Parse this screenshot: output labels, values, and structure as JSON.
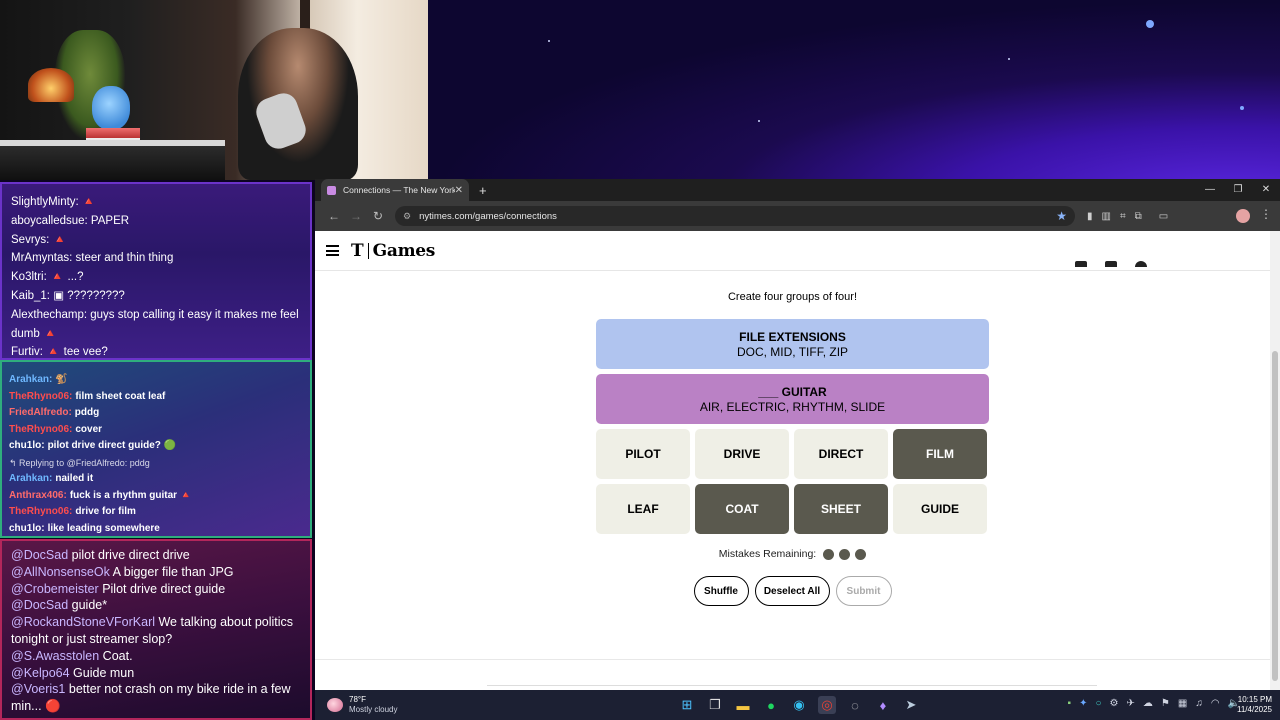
{
  "chat_panel_1": {
    "lines": [
      "SlightlyMinty: 🔺",
      "aboycalledsue: PAPER",
      "Sevrys: 🔺",
      "MrAmyntas: steer and thin thing",
      "Ko3ltri: 🔺 ...?",
      "Kaib_1: ▣ ?????????",
      "Alexthechamp: guys stop calling it easy it makes me feel dumb 🔺",
      "Furtiv: 🔺 tee vee?"
    ]
  },
  "chat_panel_2": {
    "lines": [
      {
        "user": "Arahkan:",
        "text": "🐒",
        "color": "#6fb8ff"
      },
      {
        "user": "TheRhyno06:",
        "text": "film sheet coat leaf",
        "color": "#ff4d4d"
      },
      {
        "user": "FriedAlfredo:",
        "text": "pddg",
        "color": "#ff6b6b"
      },
      {
        "user": "TheRhyno06:",
        "text": "cover",
        "color": "#ff4d4d"
      },
      {
        "user": "chu1lo:",
        "text": "pilot drive direct guide? 🟢",
        "color": "#ffffff"
      },
      {
        "user": "",
        "text": "↰ Replying to @FriedAlfredo: pddg",
        "color": "#d8d8e8",
        "reply": true
      },
      {
        "user": "Arahkan:",
        "text": "nailed it",
        "color": "#6fb8ff"
      },
      {
        "user": "Anthrax406:",
        "text": "fuck is a rhythm guitar 🔺",
        "color": "#ff6b6b"
      },
      {
        "user": "TheRhyno06:",
        "text": "drive for film",
        "color": "#ff4d4d"
      },
      {
        "user": "chu1lo:",
        "text": "like leading somewhere",
        "color": "#ffffff"
      }
    ]
  },
  "chat_panel_3": {
    "lines": [
      {
        "user": "@DocSad",
        "text": " pilot drive direct drive"
      },
      {
        "user": "@AllNonsenseOk",
        "text": " A bigger file than JPG"
      },
      {
        "user": "@Crobemeister",
        "text": " Pilot drive direct guide"
      },
      {
        "user": "@DocSad",
        "text": " guide*"
      },
      {
        "user": "@RockandStoneVForKarl",
        "text": " We talking about politics tonight or just streamer slop?"
      },
      {
        "user": "@S.Awasstolen",
        "text": " Coat."
      },
      {
        "user": "@Kelpo64",
        "text": " Guide mun"
      },
      {
        "user": "@Voeris1",
        "text": " better not crash on my bike ride in a few min... 🔴"
      }
    ]
  },
  "browser": {
    "tab_title": "Connections — The New York",
    "tab_close": "✕",
    "new_tab": "+",
    "url": "nytimes.com/games/connections",
    "window_controls": [
      "—",
      "❐",
      "✕"
    ]
  },
  "nyt": {
    "logo_t": "T",
    "logo_games": "Games",
    "subtitle": "Create four groups of four!",
    "solved": [
      {
        "category": "FILE EXTENSIONS",
        "words": "DOC, MID, TIFF, ZIP",
        "color": "#b0c4ef"
      },
      {
        "category": "___ GUITAR",
        "words": "AIR, ELECTRIC, RHYTHM, SLIDE",
        "color": "#ba81c5"
      }
    ],
    "tiles": [
      {
        "word": "PILOT",
        "selected": false
      },
      {
        "word": "DRIVE",
        "selected": false
      },
      {
        "word": "DIRECT",
        "selected": false
      },
      {
        "word": "FILM",
        "selected": true
      },
      {
        "word": "LEAF",
        "selected": false
      },
      {
        "word": "COAT",
        "selected": true
      },
      {
        "word": "SHEET",
        "selected": true
      },
      {
        "word": "GUIDE",
        "selected": false
      }
    ],
    "mistakes_label": "Mistakes Remaining:",
    "mistakes_remaining": 3,
    "buttons": {
      "shuffle": "Shuffle",
      "deselect": "Deselect All",
      "submit": "Submit"
    }
  },
  "taskbar": {
    "temp": "78°F",
    "condition": "Mostly cloudy",
    "time": "10:15 PM",
    "date": "11/4/2025"
  }
}
